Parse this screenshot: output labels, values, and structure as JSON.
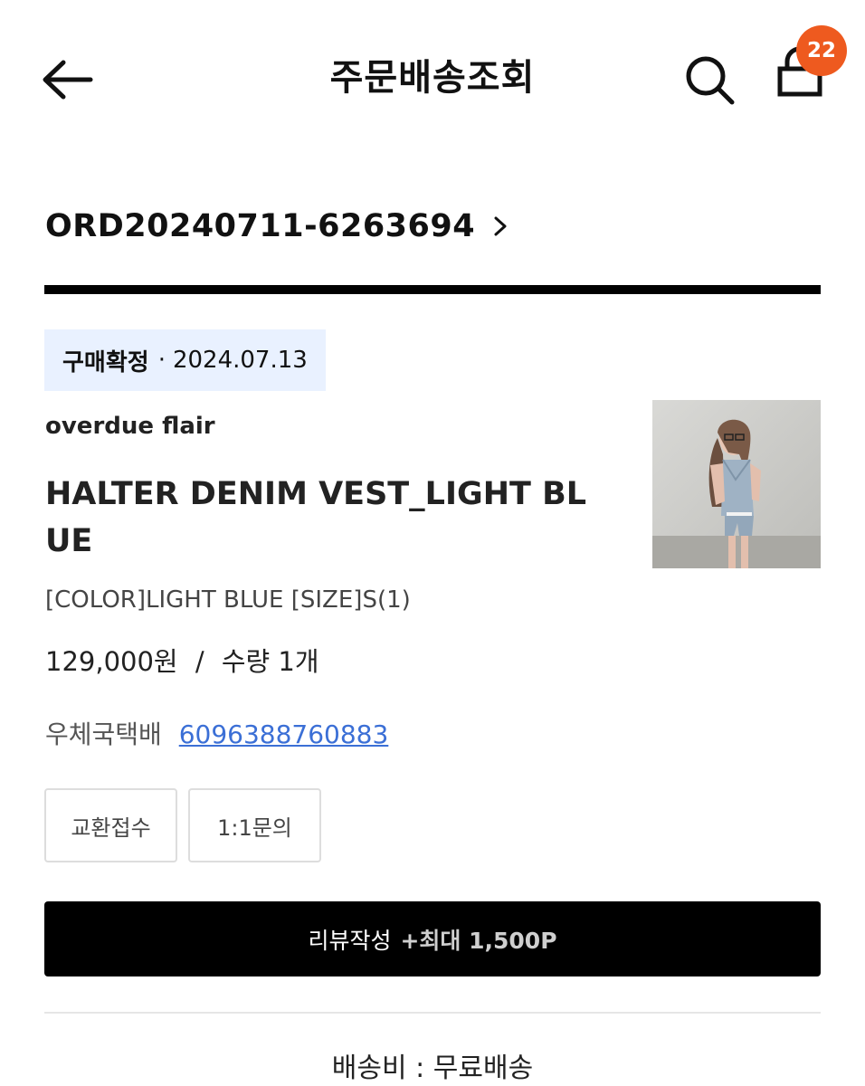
{
  "header": {
    "title": "주문배송조회",
    "back_icon": "arrow-left-icon",
    "search_icon": "search-icon",
    "cart_icon": "shopping-bag-icon",
    "cart_count": "22",
    "badge_color": "#ee5a1f"
  },
  "order": {
    "number": "ORD20240711-6263694",
    "chevron_icon": "chevron-right-icon"
  },
  "status": {
    "label": "구매확정",
    "separator": "·",
    "date": "2024.07.13",
    "chip_color": "#e9f1ff"
  },
  "product": {
    "brand": "overdue flair",
    "name": "HALTER DENIM VEST_LIGHT BLUE",
    "option": "[COLOR]LIGHT BLUE [SIZE]S(1)",
    "price": "129,000원",
    "price_separator": "/",
    "quantity": "수량 1개",
    "thumbnail": "product-photo-icon"
  },
  "shipping": {
    "courier": "우체국택배",
    "tracking_number": "6096388760883",
    "link_color": "#3b6fd6",
    "fee_text": "배송비 : 무료배송"
  },
  "actions": {
    "exchange_label": "교환접수",
    "inquiry_label": "1:1문의",
    "review_label": "리뷰작성",
    "review_points": "+최대 1,500P"
  }
}
